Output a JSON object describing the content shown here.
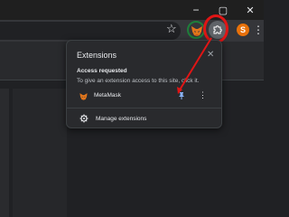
{
  "window": {
    "minimize_icon": "minimize-icon",
    "maximize_icon": "maximize-icon",
    "close_icon": "close-icon",
    "minimize_glyph": "−",
    "maximize_glyph": "▢",
    "close_glyph": "✕"
  },
  "toolbar": {
    "bookmark_glyph": "☆",
    "profile_initial": "S",
    "profile_color": "#e8710a",
    "menu_glyph": "⋮",
    "extensions_button_icon": "puzzle-icon",
    "highlight_color": "#e01515",
    "green_ring_color": "#1e7f3a"
  },
  "popup": {
    "title": "Extensions",
    "close_glyph": "✕",
    "section_heading": "Access requested",
    "section_description": "To give an extension access to this site, click it.",
    "extensions": [
      {
        "name": "MetaMask",
        "pinned": true,
        "more_glyph": "⋮"
      }
    ],
    "manage_label": "Manage extensions"
  }
}
